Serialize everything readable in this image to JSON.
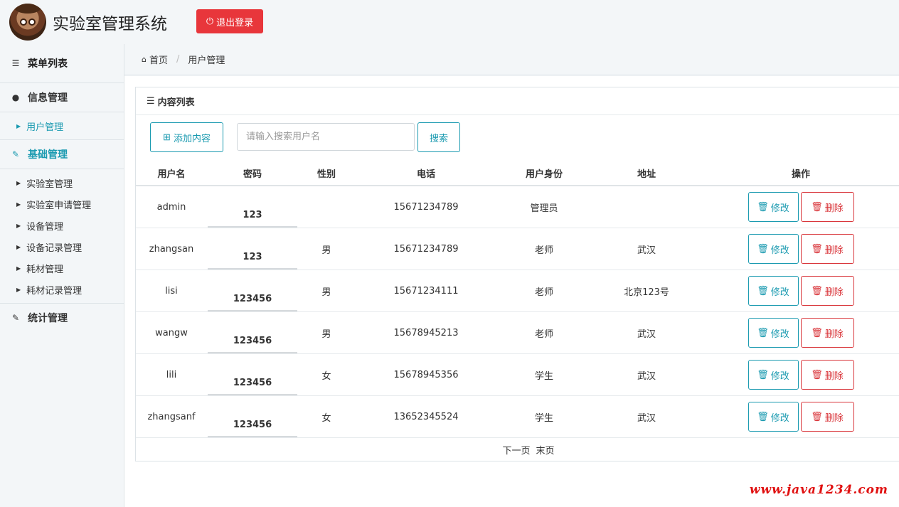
{
  "header": {
    "app_title": "实验室管理系统",
    "logout_label": "退出登录",
    "logout_icon": "power-icon"
  },
  "sidebar": {
    "title": "菜单列表",
    "groups": [
      {
        "label": "信息管理",
        "icon": "user-icon",
        "items": [
          {
            "label": "用户管理"
          }
        ]
      },
      {
        "label": "基础管理",
        "icon": "edit-icon",
        "items": [
          {
            "label": "实验室管理"
          },
          {
            "label": "实验室申请管理"
          },
          {
            "label": "设备管理"
          },
          {
            "label": "设备记录管理"
          },
          {
            "label": "耗材管理"
          },
          {
            "label": "耗材记录管理"
          }
        ]
      },
      {
        "label": "统计管理",
        "icon": "edit-icon",
        "items": []
      }
    ],
    "active_item": "用户管理",
    "accent": "#1a9ab0"
  },
  "breadcrumb": {
    "home": "首页",
    "current": "用户管理"
  },
  "panel": {
    "title": "内容列表",
    "add_label": "添加内容",
    "search_placeholder": "请输入搜索用户名",
    "search_value": "",
    "search_button": "搜索"
  },
  "table": {
    "headers": [
      "用户名",
      "密码",
      "性别",
      "电话",
      "用户身份",
      "地址",
      "操作"
    ],
    "rows": [
      {
        "username": "admin",
        "password": "123",
        "gender": "",
        "phone": "15671234789",
        "role": "管理员",
        "address": ""
      },
      {
        "username": "zhangsan",
        "password": "123",
        "gender": "男",
        "phone": "15671234789",
        "role": "老师",
        "address": "武汉"
      },
      {
        "username": "lisi",
        "password": "123456",
        "gender": "男",
        "phone": "15671234111",
        "role": "老师",
        "address": "北京123号"
      },
      {
        "username": "wangw",
        "password": "123456",
        "gender": "男",
        "phone": "15678945213",
        "role": "老师",
        "address": "武汉"
      },
      {
        "username": "lili",
        "password": "123456",
        "gender": "女",
        "phone": "15678945356",
        "role": "学生",
        "address": "武汉"
      },
      {
        "username": "zhangsanf",
        "password": "123456",
        "gender": "女",
        "phone": "13652345524",
        "role": "学生",
        "address": "武汉"
      }
    ],
    "edit_label": "修改",
    "delete_label": "删除"
  },
  "pager": {
    "next": "下一页",
    "last": "末页"
  },
  "watermark": "www.java1234.com",
  "colors": {
    "danger": "#e8363b",
    "primary": "#1a9ab0"
  }
}
